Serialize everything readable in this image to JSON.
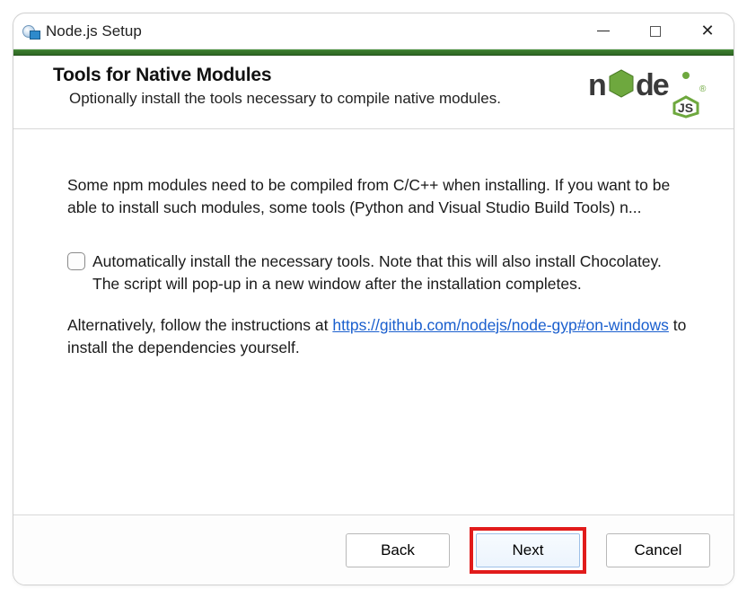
{
  "window": {
    "title": "Node.js Setup"
  },
  "header": {
    "heading": "Tools for Native Modules",
    "subheading": "Optionally install the tools necessary to compile native modules.",
    "logo_alt": "node.js"
  },
  "body": {
    "paragraph1": "Some npm modules need to be compiled from C/C++ when installing. If you want to be able to install such modules, some tools (Python and Visual Studio Build Tools) n...",
    "checkbox_label": "Automatically install the necessary tools. Note that this will also install Chocolatey. The script will pop-up in a new window after the installation completes.",
    "checkbox_checked": false,
    "alt_pre": "Alternatively, follow the instructions at ",
    "alt_link": "https://github.com/nodejs/node-gyp#on-windows",
    "alt_post": " to install the dependencies yourself."
  },
  "footer": {
    "back": "Back",
    "next": "Next",
    "cancel": "Cancel"
  },
  "colors": {
    "accent_green": "#2f6a24",
    "link_blue": "#1a5fce",
    "highlight_red": "#e11b1b"
  }
}
